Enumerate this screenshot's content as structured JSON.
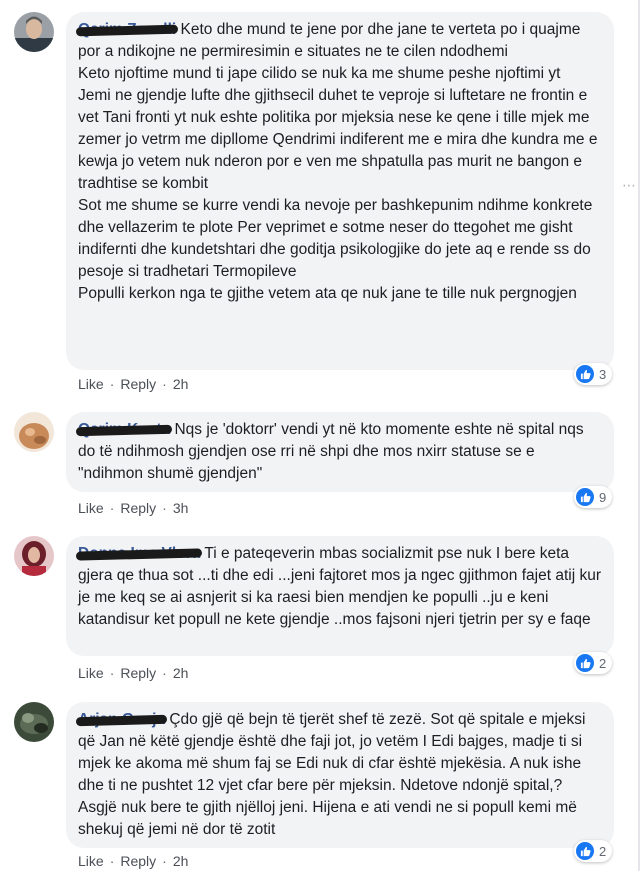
{
  "comments": [
    {
      "author": "Qerim Zenelli",
      "text": "Keto dhe mund te jene por dhe jane te verteta po i quajme por a ndikojne ne permiresimin e situates ne te cilen ndodhemi\nKeto njoftime mund ti jape cilido se nuk ka me shume peshe njoftimi yt\nJemi ne gjendje lufte dhe gjithsecil duhet te veproje si luftetare ne frontin e vet Tani fronti yt nuk eshte politika por mjeksia nese ke qene i tille mjek me zemer jo vetrm me dipllome Qendrimi indiferent me e mira dhe kundra me e kewja jo vetem nuk nderon por e ven me shpatulla pas murit ne bangon e tradhtise se kombit\nSot me shume se kurre vendi ka nevoje per bashkepunim ndihme konkrete dhe vellazerim te plote Per veprimet e sotme neser do ttegohet me gisht indifernti dhe kundetshtari dhe goditja psikologjike do jete aq e rende ss do pesoje si tradhetari Termopileve\nPopulli kerkon nga te gjithe vetem ata qe nuk jane te tille nuk pergnogjen",
      "like": "Like",
      "reply": "Reply",
      "time": "2h",
      "reactions": "3"
    },
    {
      "author": "Qerim Kosta",
      "text": "Nqs je 'doktorr' vendi yt në kto momente eshte në spital nqs do të ndihmosh gjendjen ose rri në shpi dhe mos nxirr statuse se e \"ndihmon shumë gjendjen\"",
      "like": "Like",
      "reply": "Reply",
      "time": "3h",
      "reactions": "9"
    },
    {
      "author": "Donna Ime Vlora",
      "text": "Ti e pateqeverin mbas socializmit pse nuk I bere keta gjera qe thua sot ...ti dhe edi ...jeni fajtoret mos ja ngec gjithmon fajet atij kur je me keq se ai asnjerit si ka raesi bien mendjen ke populli ..ju e keni katandisur ket popull ne kete gjendje ..mos fajsoni njeri tjetrin per sy e faqe",
      "like": "Like",
      "reply": "Reply",
      "time": "2h",
      "reactions": "2"
    },
    {
      "author": "Arjan Gosja",
      "text": "Çdo gjë që bejn të tjerët shef të zezë. Sot që spitale e mjeksi që Jan në këtë gjendje është dhe faji jot, jo vetëm I Edi bajges, madje ti si mjek ke akoma më shum faj se Edi nuk di cfar është mjekësia. A nuk ishe dhe ti ne pushtet 12 vjet cfar bere për mjeksin. Ndetove ndonjë spital,? Asgjë nuk bere te gjith njëlloj jeni. Hijena e ati vendi ne si popull kemi më shekuj që jemi në dor të zotit",
      "like": "Like",
      "reply": "Reply",
      "time": "2h",
      "reactions": "2"
    }
  ],
  "colors": {
    "bubble": "#f2f3f5",
    "link": "#385898",
    "like_blue": "#1877f2"
  }
}
